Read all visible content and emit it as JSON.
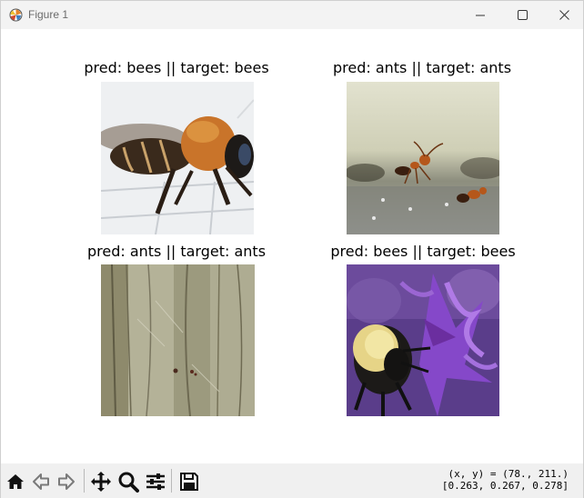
{
  "window": {
    "title": "Figure 1",
    "icons": {
      "app": "matplotlib-icon",
      "minimize": "minimize-icon",
      "maximize": "maximize-icon",
      "close": "close-icon"
    }
  },
  "subplots": [
    {
      "title": "pred: bees || target: bees",
      "image": "bee-on-white-tile-photo"
    },
    {
      "title": "pred: ants || target: ants",
      "image": "ants-on-rock-photo"
    },
    {
      "title": "pred: ants || target: ants",
      "image": "wood-texture-photo"
    },
    {
      "title": "pred: bees || target: bees",
      "image": "bumblebee-on-purple-flower-photo"
    }
  ],
  "toolbar": {
    "tools": [
      "home-icon",
      "back-icon",
      "forward-icon",
      "pan-icon",
      "zoom-icon",
      "configure-subplots-icon",
      "save-icon"
    ],
    "coords_line1": "(x, y) = (78., 211.)",
    "coords_line2": "[0.263, 0.267, 0.278]"
  }
}
